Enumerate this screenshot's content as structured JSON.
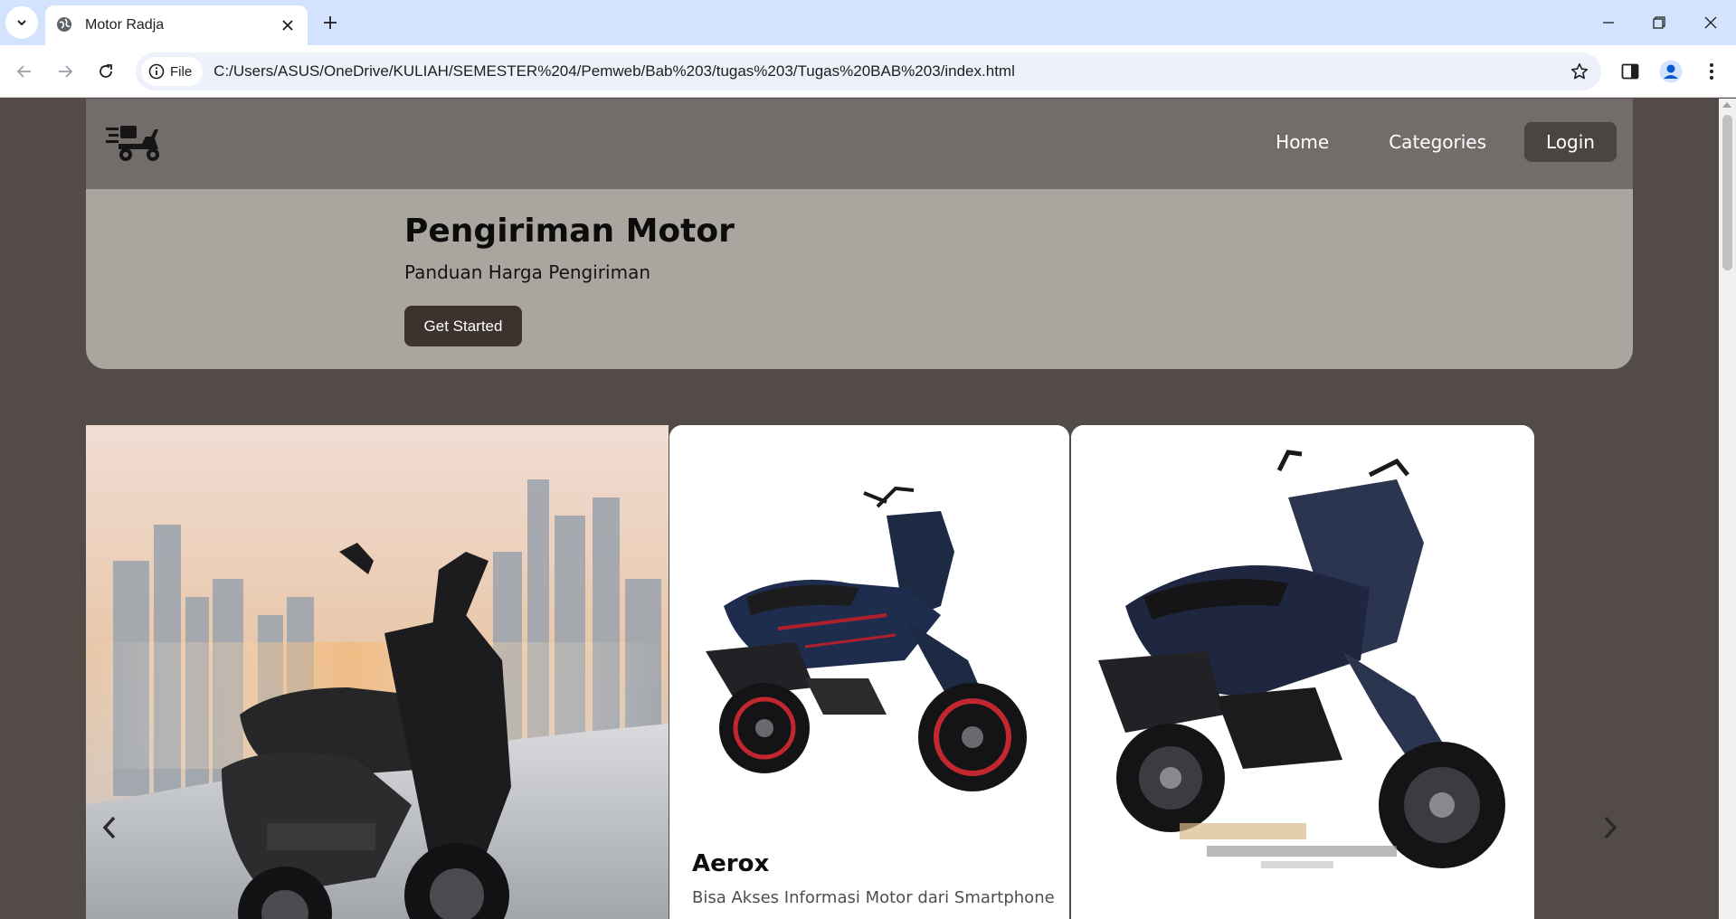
{
  "browser": {
    "tab_title": "Motor Radja",
    "site_chip": "File",
    "url": "C:/Users/ASUS/OneDrive/KULIAH/SEMESTER%204/Pemweb/Bab%203/tugas%203/Tugas%20BAB%203/index.html"
  },
  "nav": {
    "logo": "delivery-scooter-icon",
    "links": [
      {
        "label": "Home"
      },
      {
        "label": "Categories"
      },
      {
        "label": "Login"
      }
    ]
  },
  "hero": {
    "title": "Pengiriman Motor",
    "subtitle": "Panduan Harga Pengiriman",
    "cta": "Get Started"
  },
  "carousel": {
    "cards": [
      {
        "image": "black-nmax-scooter-city-skyline"
      },
      {
        "image": "blue-aerox-scooter",
        "title": "Aerox",
        "description": "Bisa Akses Informasi Motor dari Smartphone"
      },
      {
        "image": "blue-vario-scooter"
      }
    ]
  },
  "colors": {
    "page_bg": "#524b47",
    "nav_bg": "#726d6a",
    "hero_bg": "#aaa59f",
    "button_dark": "#3c332e",
    "tabbar": "#d3e3fd"
  }
}
